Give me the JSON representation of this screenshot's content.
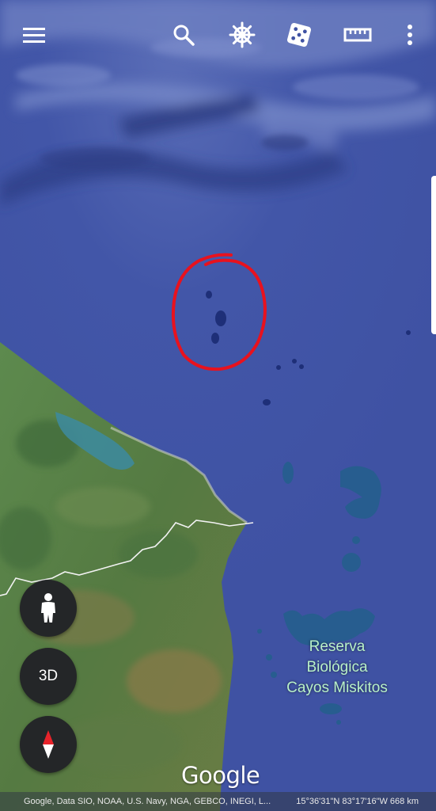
{
  "toolbar": {
    "menu_icon": "hamburger-menu-icon",
    "search_icon": "search-icon",
    "voyager_icon": "ship-wheel-icon",
    "feeling_lucky_icon": "dice-icon",
    "measure_icon": "ruler-icon",
    "more_icon": "more-vertical-icon"
  },
  "map": {
    "ocean_color": "#3f55a8",
    "annotation_color": "#e8121e",
    "border_line_color": "#ffffff",
    "place_label": {
      "line1": "Reserva",
      "line2": "Biológica",
      "line3": "Cayos Miskitos"
    }
  },
  "controls": {
    "pegman_icon": "pegman-icon",
    "three_d_label": "3D",
    "compass_icon": "compass-icon"
  },
  "branding": {
    "logo_text": "Google"
  },
  "footer": {
    "attribution": "Google, Data SIO, NOAA, U.S. Navy, NGA, GEBCO, INEGI, L...",
    "coordinates": "15°36'31\"N 83°17'16\"W 668 km"
  }
}
